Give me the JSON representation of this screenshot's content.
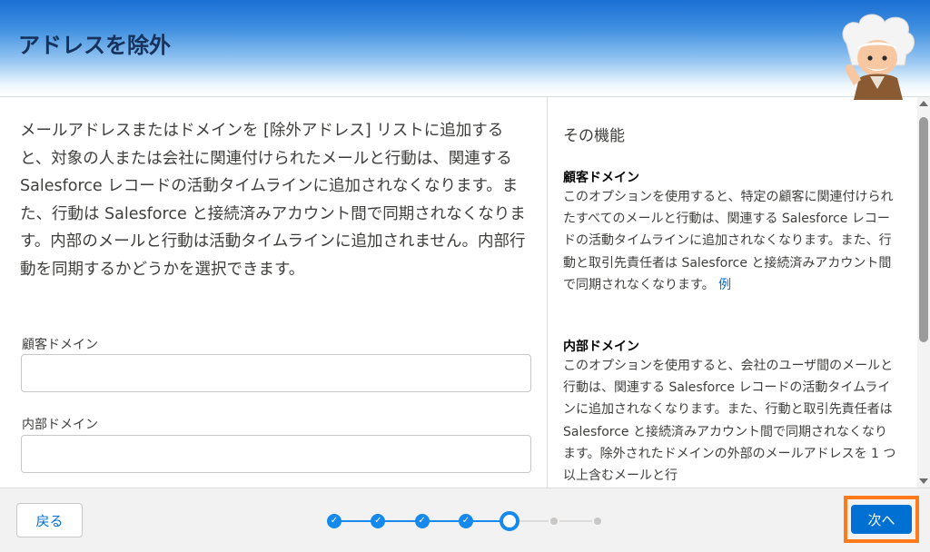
{
  "header": {
    "title": "アドレスを除外"
  },
  "intro": "メールアドレスまたはドメインを [除外アドレス] リストに追加すると、対象の人または会社に関連付けられたメールと行動は、関連する Salesforce レコードの活動タイムラインに追加されなくなります。また、行動は Salesforce と接続済みアカウント間で同期されなくなります。内部のメールと行動は活動タイムラインに追加されません。内部行動を同期するかどうかを選択できます。",
  "fields": {
    "customer_domain_label": "顧客ドメイン",
    "customer_domain_value": "",
    "internal_domain_label": "内部ドメイン",
    "internal_domain_value": ""
  },
  "sidebar": {
    "title": "その機能",
    "customer_title": "顧客ドメイン",
    "customer_body": "このオプションを使用すると、特定の顧客に関連付けられたすべてのメールと行動は、関連する Salesforce レコードの活動タイムラインに追加されなくなります。また、行動と取引先責任者は Salesforce と接続済みアカウント間で同期されなくなります。",
    "customer_link": "例",
    "internal_title": "内部ドメイン",
    "internal_body": "このオプションを使用すると、会社のユーザ間のメールと行動は、関連する Salesforce レコードの活動タイムラインに追加されなくなります。また、行動と取引先責任者は Salesforce と接続済みアカウント間で同期されなくなります。除外されたドメインの外部のメールアドレスを 1 つ以上含むメールと行"
  },
  "footer": {
    "back_label": "戻る",
    "next_label": "次へ",
    "steps_total": 7,
    "steps_completed": 4,
    "current_step": 5
  },
  "colors": {
    "brand_blue": "#0070d2",
    "step_blue": "#1589ee",
    "highlight_orange": "#ff7a1a"
  }
}
